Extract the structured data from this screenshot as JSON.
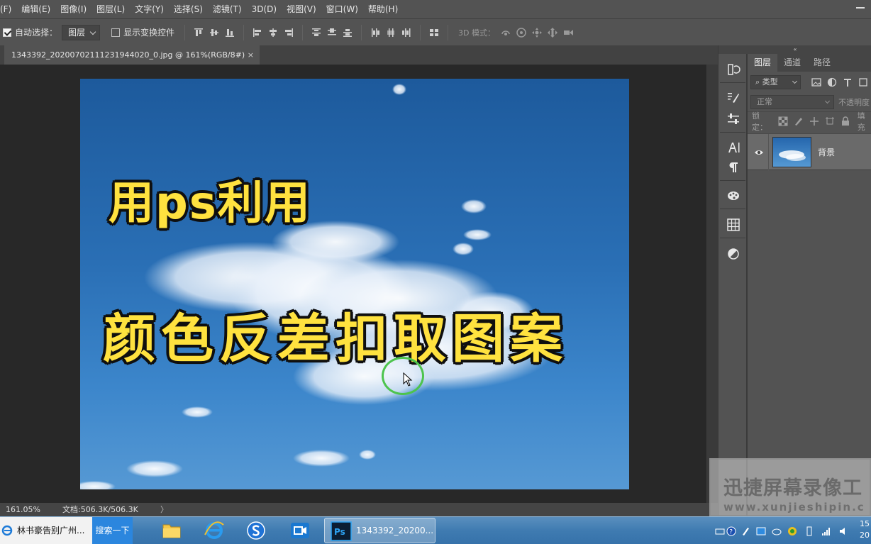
{
  "menubar": {
    "items": [
      "文件(F)",
      "编辑(E)",
      "图像(I)",
      "图层(L)",
      "文字(Y)",
      "选择(S)",
      "滤镜(T)",
      "3D(D)",
      "视图(V)",
      "窗口(W)",
      "帮助(H)"
    ],
    "first_visible": "(F)"
  },
  "options": {
    "auto_select_label": "自动选择：",
    "auto_select_value": "图层",
    "show_transform_label": "显示变换控件",
    "mode_3d_label": "3D 模式："
  },
  "document": {
    "tab_title": "1343392_20200702111231944020_0.jpg @ 161%(RGB/8#)",
    "close_glyph": "×",
    "overlay_line1": "用ps利用",
    "overlay_line2": "颜色反差扣取图案"
  },
  "status": {
    "zoom": "161.05%",
    "doc_info": "文档:506.3K/506.3K",
    "arrow": "〉"
  },
  "strip": {
    "collapse_glyph": "«"
  },
  "layers_panel": {
    "tabs": [
      "图层",
      "通道",
      "路径"
    ],
    "active_tab": "图层",
    "filter_label": "类型",
    "blend_mode": "正常",
    "opacity_label": "不透明度",
    "lock_label": "锁定：",
    "fill_label": "填充",
    "layers": [
      {
        "name": "背景",
        "visible": true
      }
    ]
  },
  "watermark": {
    "title": "迅捷屏幕录像工",
    "url": "www.xunjieshipin.c"
  },
  "taskbar": {
    "ie_label": "林书豪告别广州...",
    "search_label": "搜索一下",
    "ps_label": "1343392_20200...",
    "clock_time": "15",
    "clock_date": "20"
  },
  "colors": {
    "accent_overlay_text": "#ffe23f",
    "cursor_ring": "#4dc44d",
    "ui_panel": "#535353",
    "taskbar": "#3f7bb1"
  },
  "icons": [
    "check-icon",
    "align-top-icon",
    "align-vcenter-icon",
    "align-bottom-icon",
    "align-left-icon",
    "align-hcenter-icon",
    "align-right-icon",
    "distribute-icon",
    "3d-rotate-icon",
    "3d-roll-icon",
    "3d-pan-icon",
    "3d-slide-icon",
    "3d-scale-icon",
    "history-icon",
    "brush-presets-icon",
    "adjust-icon",
    "character-icon",
    "paragraph-icon",
    "palette-icon",
    "grid-icon",
    "adjustment-icon",
    "eye-icon",
    "lock-icon",
    "ie-icon",
    "folder-icon",
    "search-s-icon",
    "video-icon",
    "ps-icon"
  ]
}
